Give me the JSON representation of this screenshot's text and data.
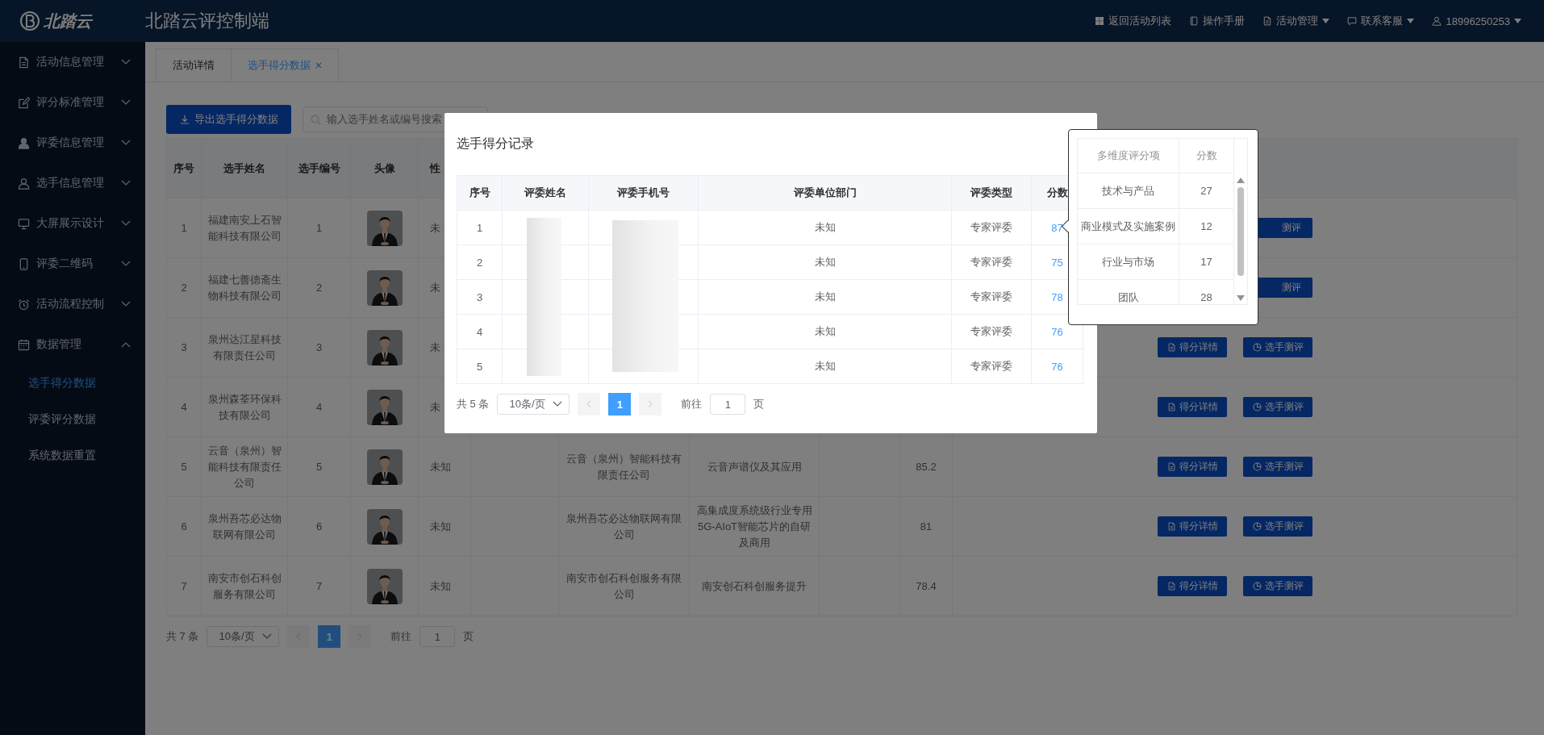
{
  "header": {
    "logo_text": "北踏云",
    "title": "北踏云评控制端",
    "nav": [
      {
        "kind": "grid",
        "label": "返回活动列表",
        "dropdown": false
      },
      {
        "kind": "book",
        "label": "操作手册",
        "dropdown": false
      },
      {
        "kind": "doc",
        "label": "活动管理",
        "dropdown": true
      },
      {
        "kind": "chat",
        "label": "联系客服",
        "dropdown": true
      },
      {
        "kind": "user",
        "label": "18996250253",
        "dropdown": true
      }
    ]
  },
  "sidebar": {
    "items": [
      {
        "label": "活动信息管理",
        "expanded": false
      },
      {
        "label": "评分标准管理",
        "expanded": false
      },
      {
        "label": "评委信息管理",
        "expanded": false
      },
      {
        "label": "选手信息管理",
        "expanded": false
      },
      {
        "label": "大屏展示设计",
        "expanded": false
      },
      {
        "label": "评委二维码",
        "expanded": false
      },
      {
        "label": "活动流程控制",
        "expanded": false
      },
      {
        "label": "数据管理",
        "expanded": true,
        "children": [
          {
            "label": "选手得分数据",
            "selected": true
          },
          {
            "label": "评委评分数据",
            "selected": false
          },
          {
            "label": "系统数据重置",
            "selected": false
          }
        ]
      }
    ]
  },
  "tabs": [
    {
      "label": "活动详情",
      "selected": false,
      "closable": false
    },
    {
      "label": "选手得分数据",
      "selected": true,
      "closable": true
    }
  ],
  "toolbar": {
    "export_button": "导出选手得分数据",
    "search": {
      "placeholder": "输入选手姓名或编号搜索"
    }
  },
  "table": {
    "columns": [
      "序号",
      "选手姓名",
      "选手编号",
      "头像",
      "性"
    ],
    "rows": [
      {
        "index": "1",
        "name": "福建南安上石智能科技有限公司",
        "number": "1",
        "avatar": {
          "kind": "picture"
        },
        "gender": "未",
        "actions": [
          {
            "kind": "clipped",
            "label": "测评"
          }
        ]
      },
      {
        "index": "2",
        "name": "福建七善德斋生物科技有限公司",
        "number": "2",
        "avatar": {
          "kind": "picture"
        },
        "gender": "未",
        "actions": [
          {
            "kind": "clipped",
            "label": "测评"
          }
        ]
      },
      {
        "index": "3",
        "name": "泉州达江星科技有限责任公司",
        "number": "3",
        "avatar": {
          "kind": "picture"
        },
        "gender": "未",
        "actions": [
          {
            "kind": "detail",
            "label": "得分详情"
          },
          {
            "kind": "evaluate",
            "label": "选手测评"
          }
        ]
      },
      {
        "index": "4",
        "name": "泉州森荃环保科技有限公司",
        "number": "4",
        "avatar": {
          "kind": "picture"
        },
        "gender": "未",
        "actions": [
          {
            "kind": "detail",
            "label": "得分详情"
          },
          {
            "kind": "evaluate",
            "label": "选手测评"
          }
        ]
      },
      {
        "index": "5",
        "name": "云音（泉州）智能科技有限责任公司",
        "number": "5",
        "avatar": {
          "kind": "picture"
        },
        "gender": "未知",
        "company": "云音（泉州）智能科技有限责任公司",
        "project": "云音声谱仪及其应用",
        "score": "85.2",
        "actions": [
          {
            "kind": "detail",
            "label": "得分详情"
          },
          {
            "kind": "evaluate",
            "label": "选手测评"
          }
        ]
      },
      {
        "index": "6",
        "name": "泉州吾芯必达物联网有限公司",
        "number": "6",
        "avatar": {
          "kind": "picture"
        },
        "gender": "未知",
        "company": "泉州吾芯必达物联网有限公司",
        "project": "高集成度系统级行业专用5G-AIoT智能芯片的自研及商用",
        "score": "81",
        "actions": [
          {
            "kind": "detail",
            "label": "得分详情"
          },
          {
            "kind": "evaluate",
            "label": "选手测评"
          }
        ]
      },
      {
        "index": "7",
        "name": "南安市创石科创服务有限公司",
        "number": "7",
        "avatar": {
          "kind": "picture"
        },
        "gender": "未知",
        "company": "南安市创石科创服务有限公司",
        "project": "南安创石科创服务提升",
        "score": "78.4",
        "actions": [
          {
            "kind": "detail",
            "label": "得分详情"
          },
          {
            "kind": "evaluate",
            "label": "选手测评"
          }
        ]
      }
    ],
    "pagination": {
      "total": "共 7 条",
      "page_size": "10条/页",
      "current_page": "1",
      "goto_label": "前往",
      "goto_value": "1",
      "page_suffix": "页"
    }
  },
  "modal": {
    "title": "选手得分记录",
    "columns": [
      "序号",
      "评委姓名",
      "评委手机号",
      "评委单位部门",
      "评委类型",
      "分数"
    ],
    "rows": [
      {
        "index": "1",
        "department": "未知",
        "type": "专家评委",
        "score": "87"
      },
      {
        "index": "2",
        "department": "未知",
        "type": "专家评委",
        "score": "75"
      },
      {
        "index": "3",
        "department": "未知",
        "type": "专家评委",
        "score": "78"
      },
      {
        "index": "4",
        "department": "未知",
        "type": "专家评委",
        "score": "76"
      },
      {
        "index": "5",
        "department": "未知",
        "type": "专家评委",
        "score": "76"
      }
    ],
    "pagination": {
      "total": "共 5 条",
      "page_size": "10条/页",
      "current_page": "1",
      "goto_label": "前往",
      "goto_value": "1",
      "page_suffix": "页"
    }
  },
  "popover": {
    "columns": [
      "多维度评分项",
      "分数"
    ],
    "rows": [
      {
        "item": "技术与产品",
        "score": "27"
      },
      {
        "item": "商业模式及实施案例",
        "score": "12"
      },
      {
        "item": "行业与市场",
        "score": "17"
      },
      {
        "item": "团队",
        "score": "28"
      }
    ]
  }
}
